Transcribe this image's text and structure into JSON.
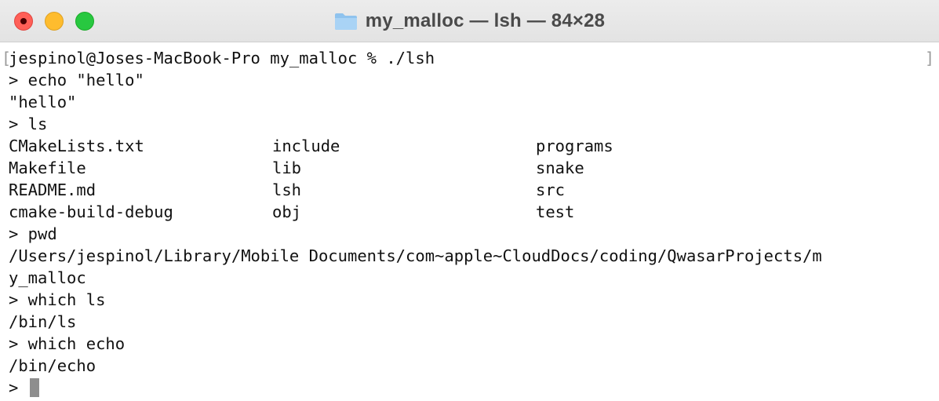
{
  "window": {
    "title": "my_malloc — lsh — 84×28"
  },
  "terminal": {
    "prompt_line": "jespinol@Joses-MacBook-Pro my_malloc % ./lsh",
    "cmd_echo": "> echo \"hello\"",
    "out_echo": "\"hello\"",
    "cmd_ls": "> ls",
    "ls_rows": [
      [
        "CMakeLists.txt",
        "include",
        "programs"
      ],
      [
        "Makefile",
        "lib",
        "snake"
      ],
      [
        "README.md",
        "lsh",
        "src"
      ],
      [
        "cmake-build-debug",
        "obj",
        "test"
      ]
    ],
    "cmd_pwd": "> pwd",
    "out_pwd_1": "/Users/jespinol/Library/Mobile Documents/com~apple~CloudDocs/coding/QwasarProjects/m",
    "out_pwd_2": "y_malloc",
    "cmd_which_ls": "> which ls",
    "out_which_ls": "/bin/ls",
    "cmd_which_echo": "> which echo",
    "out_which_echo": "/bin/echo",
    "current_prompt": "> "
  },
  "colors": {
    "close": "#ff5f57",
    "minimize": "#febc2e",
    "zoom": "#28c840",
    "cursor": "#8e8e8e"
  },
  "icons": {
    "title_icon": "folder-icon"
  }
}
